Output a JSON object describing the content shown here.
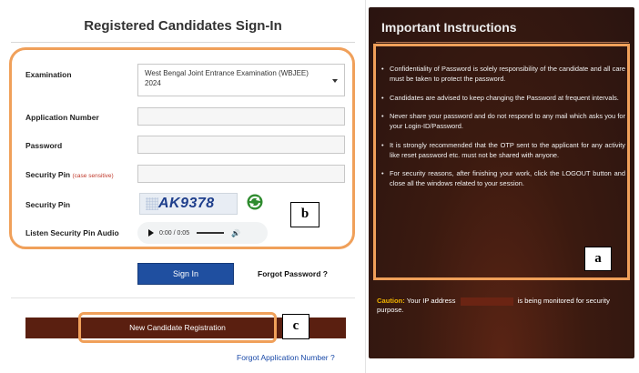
{
  "signin_panel": {
    "title": "Registered Candidates Sign-In",
    "examination": {
      "label": "Examination",
      "value": "West Bengal Joint Entrance Examination (WBJEE) 2024"
    },
    "application_number": {
      "label": "Application Number",
      "value": ""
    },
    "password": {
      "label": "Password",
      "value": ""
    },
    "security_pin_input": {
      "label": "Security Pin",
      "hint": "(case sensitive)",
      "value": ""
    },
    "security_pin_captcha": {
      "label": "Security Pin",
      "code": "AK9378",
      "refresh_icon": "refresh-icon"
    },
    "audio": {
      "label": "Listen Security Pin Audio",
      "time": "0:00 / 0:05",
      "play_icon": "play-icon",
      "volume_icon": "volume-icon"
    },
    "sign_in_label": "Sign In",
    "forgot_password_label": "Forgot Password ?",
    "new_registration_label": "New Candidate Registration",
    "forgot_application_label": "Forgot Application Number ?"
  },
  "instructions_panel": {
    "title": "Important Instructions",
    "items": [
      "Confidentiality of Password is solely responsibility of the candidate and all care must be taken to protect the password.",
      "Candidates are advised to keep changing the Password at frequent intervals.",
      "Never share your password and do not respond to any mail which asks you for your Login-ID/Password.",
      "It is strongly recommended that the OTP sent to the applicant for any activity like reset password etc. must not be shared with anyone.",
      "For security reasons, after finishing your work, click the LOGOUT button and close all the windows related to your session."
    ],
    "caution": {
      "label": "Caution:",
      "text_before": "Your IP address",
      "text_after": "is being monitored for security purpose."
    }
  },
  "annotations": {
    "a": "a",
    "b": "b",
    "c": "c"
  },
  "colors": {
    "highlight": "#f0a05a",
    "sign_in_button": "#1f4fa0",
    "registration_bar": "#5a1f10",
    "instructions_bg": "#3b1a10",
    "caution_label": "#f1b400"
  }
}
